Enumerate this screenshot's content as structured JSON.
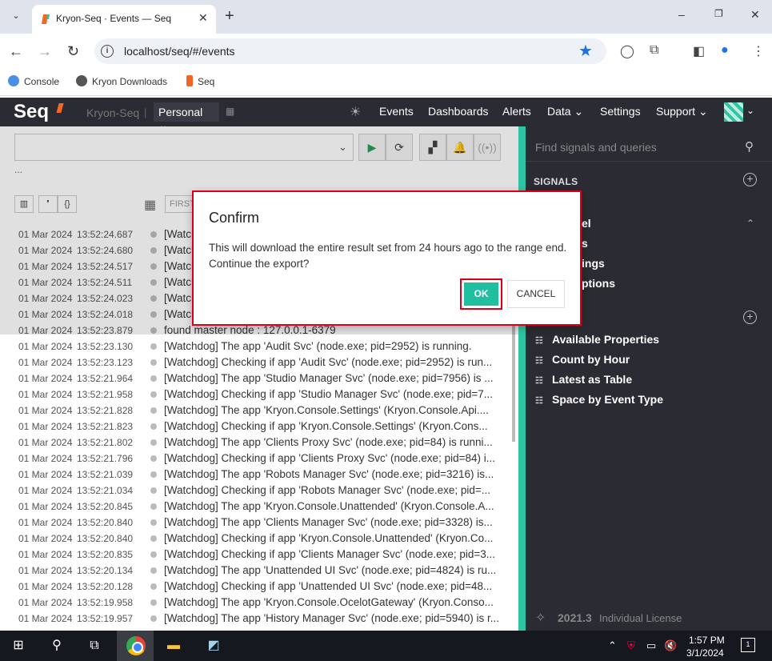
{
  "browser": {
    "tab_title": "Kryon-Seq · Events — Seq",
    "url": "localhost/seq/#/events",
    "bookmarks": [
      "Console",
      "Kryon Downloads",
      "Seq"
    ]
  },
  "seq_header": {
    "logo": "Seq",
    "instance": "Kryon-Seq",
    "separator": "|",
    "workspace": "Personal",
    "nav": [
      "Events",
      "Dashboards",
      "Alerts",
      "Data",
      "Settings",
      "Support"
    ]
  },
  "toolbar": {
    "ellipsis": "...",
    "first_placeholder": "FIRST"
  },
  "events": [
    {
      "date": "01 Mar 2024",
      "time": "13:52:24.687",
      "msg": "[Watchdog] Checking if app 'Host Svc' (node.exe; pid=2916) is running."
    },
    {
      "date": "01 Mar 2024",
      "time": "13:52:24.680",
      "msg": "[Watchdog] The app 'Host Svc' (node.exe; pid=2916) is running."
    },
    {
      "date": "01 Mar 2024",
      "time": "13:52:24.517",
      "msg": "[Watchdog] Checking if app 'Scheduler Svc' (node.exe) is running."
    },
    {
      "date": "01 Mar 2024",
      "time": "13:52:24.511",
      "msg": "[Watchdog] The app 'Scheduler Svc' (node.exe) is running."
    },
    {
      "date": "01 Mar 2024",
      "time": "13:52:24.023",
      "msg": "[Watchdog] Checking if app 'Redis' is running."
    },
    {
      "date": "01 Mar 2024",
      "time": "13:52:24.018",
      "msg": "[Watchdog] The app 'Redis' is running."
    },
    {
      "date": "01 Mar 2024",
      "time": "13:52:23.879",
      "msg": "found master node : 127.0.0.1-6379"
    },
    {
      "date": "01 Mar 2024",
      "time": "13:52:23.130",
      "msg": "[Watchdog] The app 'Audit Svc' (node.exe; pid=2952) is running."
    },
    {
      "date": "01 Mar 2024",
      "time": "13:52:23.123",
      "msg": "[Watchdog] Checking if app 'Audit Svc' (node.exe; pid=2952) is run..."
    },
    {
      "date": "01 Mar 2024",
      "time": "13:52:21.964",
      "msg": "[Watchdog] The app 'Studio Manager Svc' (node.exe; pid=7956) is ..."
    },
    {
      "date": "01 Mar 2024",
      "time": "13:52:21.958",
      "msg": "[Watchdog] Checking if app 'Studio Manager Svc' (node.exe; pid=7..."
    },
    {
      "date": "01 Mar 2024",
      "time": "13:52:21.828",
      "msg": "[Watchdog] The app 'Kryon.Console.Settings' (Kryon.Console.Api...."
    },
    {
      "date": "01 Mar 2024",
      "time": "13:52:21.823",
      "msg": "[Watchdog] Checking if app 'Kryon.Console.Settings' (Kryon.Cons..."
    },
    {
      "date": "01 Mar 2024",
      "time": "13:52:21.802",
      "msg": "[Watchdog] The app 'Clients Proxy Svc' (node.exe; pid=84) is runni..."
    },
    {
      "date": "01 Mar 2024",
      "time": "13:52:21.796",
      "msg": "[Watchdog] Checking if app 'Clients Proxy Svc' (node.exe; pid=84) i..."
    },
    {
      "date": "01 Mar 2024",
      "time": "13:52:21.039",
      "msg": "[Watchdog] The app 'Robots Manager Svc' (node.exe; pid=3216) is..."
    },
    {
      "date": "01 Mar 2024",
      "time": "13:52:21.034",
      "msg": "[Watchdog] Checking if app 'Robots Manager Svc' (node.exe; pid=..."
    },
    {
      "date": "01 Mar 2024",
      "time": "13:52:20.845",
      "msg": "[Watchdog] The app 'Kryon.Console.Unattended' (Kryon.Console.A..."
    },
    {
      "date": "01 Mar 2024",
      "time": "13:52:20.840",
      "msg": "[Watchdog] The app 'Clients Manager Svc' (node.exe; pid=3328) is..."
    },
    {
      "date": "01 Mar 2024",
      "time": "13:52:20.840",
      "msg": "[Watchdog] Checking if app 'Kryon.Console.Unattended' (Kryon.Co..."
    },
    {
      "date": "01 Mar 2024",
      "time": "13:52:20.835",
      "msg": "[Watchdog] Checking if app 'Clients Manager Svc' (node.exe; pid=3..."
    },
    {
      "date": "01 Mar 2024",
      "time": "13:52:20.134",
      "msg": "[Watchdog] The app 'Unattended UI Svc' (node.exe; pid=4824) is ru..."
    },
    {
      "date": "01 Mar 2024",
      "time": "13:52:20.128",
      "msg": "[Watchdog] Checking if app 'Unattended UI Svc' (node.exe; pid=48..."
    },
    {
      "date": "01 Mar 2024",
      "time": "13:52:19.958",
      "msg": "[Watchdog] The app 'Kryon.Console.OcelotGateway' (Kryon.Conso..."
    },
    {
      "date": "01 Mar 2024",
      "time": "13:52:19.957",
      "msg": "[Watchdog] The app 'History Manager Svc' (node.exe; pid=5940) is r..."
    }
  ],
  "signals_pane": {
    "search_placeholder": "Find signals and queries",
    "signals_heading": "SIGNALS",
    "partial_labels": [
      "el",
      "s",
      "ings",
      "ptions"
    ],
    "queries": [
      "Available Properties",
      "Count by Hour",
      "Latest as Table",
      "Space by Event Type"
    ],
    "version": "2021.3",
    "license": "Individual License"
  },
  "dialog": {
    "title": "Confirm",
    "body": "This will download the entire result set from 24 hours ago to the range end. Continue the export?",
    "ok_label": "OK",
    "cancel_label": "CANCEL"
  },
  "taskbar": {
    "time": "1:57 PM",
    "date": "3/1/2024",
    "notification_count": "1"
  },
  "colors": {
    "seq_dark": "#2b2b33",
    "accent_teal": "#2ec4a3",
    "ok_green": "#1fbfa0",
    "highlight_red": "#d9001b",
    "seq_orange": "#f26522"
  }
}
